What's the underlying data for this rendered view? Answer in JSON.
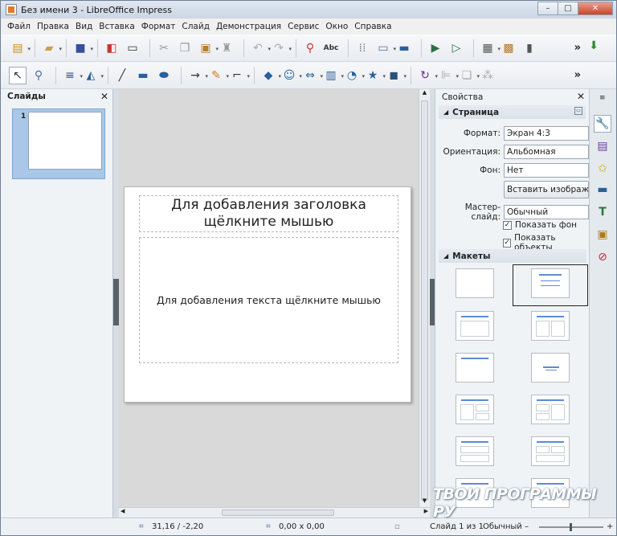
{
  "window": {
    "title": "Без имени 3 - LibreOffice Impress",
    "buttons": {
      "minimize": "–",
      "maximize": "□",
      "close": "✕"
    }
  },
  "menu": [
    "Файл",
    "Правка",
    "Вид",
    "Вставка",
    "Формат",
    "Слайд",
    "Демонстрация",
    "Сервис",
    "Окно",
    "Справка"
  ],
  "toolbar": {
    "overflow": "»"
  },
  "slides_panel": {
    "title": "Слайды",
    "close": "✕",
    "slide_number": "1"
  },
  "slide": {
    "title_placeholder": "Для добавления заголовка щёлкните мышью",
    "body_placeholder": "Для добавления текста щёлкните мышью"
  },
  "properties": {
    "title": "Свойства",
    "page_section": "Страница",
    "format_label": "Формат:",
    "format_value": "Экран 4:3",
    "orientation_label": "Ориентация:",
    "orientation_value": "Альбомная",
    "background_label": "Фон:",
    "background_value": "Нет",
    "insert_image_button": "Вставить изображение",
    "master_label": "Мастер-слайд:",
    "master_value": "Обычный",
    "show_background": "Показать фон",
    "show_objects": "Показать объекты",
    "layouts_section": "Макеты"
  },
  "status": {
    "position": "31,16 / -2,20",
    "size": "0,00 x 0,00",
    "slide_info": "Слайд 1 из 1",
    "master": "Обычный"
  },
  "watermark": "ТВОИ ПРОГРАММЫ РУ"
}
